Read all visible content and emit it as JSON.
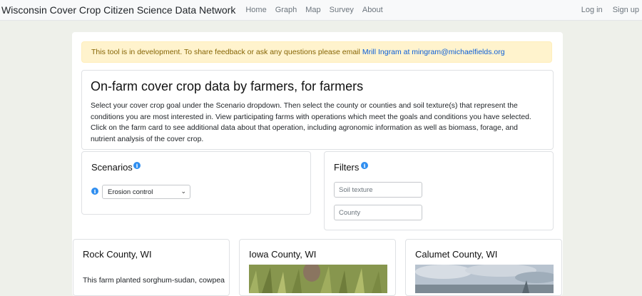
{
  "navbar": {
    "brand": "Wisconsin Cover Crop Citizen Science Data Network",
    "links": [
      "Home",
      "Graph",
      "Map",
      "Survey",
      "About"
    ],
    "login": "Log in",
    "signup": "Sign up"
  },
  "alert": {
    "text": "This tool is in development. To share feedback or ask any questions please email",
    "link": "Mrill Ingram at mingram@michaelfields.org"
  },
  "intro": {
    "heading": "On-farm cover crop data by farmers, for farmers",
    "body": "Select your cover crop goal under the Scenario dropdown. Then select the county or counties and soil texture(s) that represent the conditions you are most interested in. View participating farms with operations which meet the goals and conditions you have selected. Click on the farm card to see additional data about that operation, including agronomic information as well as biomass, forage, and nutrient analysis of the cover crop."
  },
  "scenarios": {
    "title": "Scenarios",
    "selected": "Erosion control"
  },
  "filters": {
    "title": "Filters",
    "soil_placeholder": "Soil texture",
    "county_placeholder": "County"
  },
  "cards": [
    {
      "title": "Rock County, WI",
      "text": "This farm planted sorghum-sudan, cowpea"
    },
    {
      "title": "Iowa County, WI"
    },
    {
      "title": "Calumet County, WI"
    }
  ],
  "colors": {
    "accent": "#2f8ef0",
    "alert_bg": "#fff3cd",
    "alert_text": "#856404",
    "link": "#0b5ed7"
  }
}
